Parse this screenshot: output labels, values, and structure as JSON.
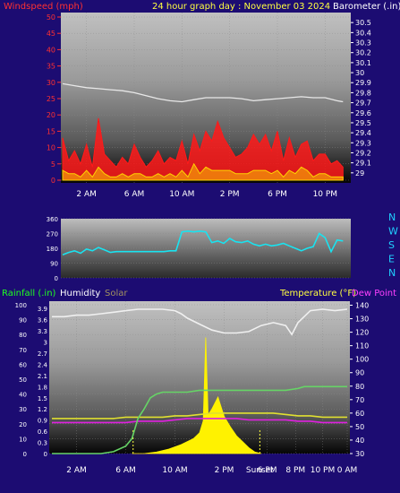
{
  "colors": {
    "background": "#1c0c72",
    "wind_gust": "#ff1a1a",
    "wind_avg": "#ffd400",
    "barometer": "#e8e8e8",
    "direction": "#19e3f0",
    "humidity": "#f0f0f0",
    "temperature": "#e0e030",
    "dew_point": "#e020e0",
    "rainfall": "#66d466",
    "solar": "#fff200",
    "label_red": "#ff3030",
    "label_white": "#ffffff",
    "label_yellow": "#ffff40",
    "label_cyan": "#20d0ff",
    "label_tan": "#a09060",
    "label_magenta": "#ff40ff",
    "label_green": "#20ff20"
  },
  "labels": {
    "top_left": "Windspeed (mph)",
    "top_center": "24 hour graph day : November 03 2024",
    "top_right": "Barometer (.in)",
    "rainfall": "Rainfall (.in)",
    "humidity": "Humidity",
    "solar": "Solar",
    "temperature": "Temperature (°F)",
    "dew_point": "Dew Point ("
  },
  "chart_data": [
    {
      "type": "area",
      "name": "wind",
      "time_ticks": [
        "2 AM",
        "6 AM",
        "10 AM",
        "2 PM",
        "6 PM",
        "10 PM"
      ],
      "time_tick_hours": [
        2,
        6,
        10,
        14,
        18,
        22
      ],
      "left_axis": {
        "ticks": [
          0,
          5,
          10,
          15,
          20,
          25,
          30,
          35,
          40,
          45,
          50
        ],
        "ylim": [
          0,
          50
        ]
      },
      "right_axis": {
        "ticks": [
          "29",
          "29.1",
          "29.2",
          "29.3",
          "29.4",
          "29.5",
          "29.6",
          "29.7",
          "29.8",
          "29.9",
          "30",
          "30.1",
          "30.2",
          "30.3",
          "30.4",
          "30.5"
        ],
        "ylim": [
          28.9,
          30.6
        ]
      },
      "series": [
        {
          "key": "gust",
          "color_key": "wind_gust",
          "x": [
            0,
            0.5,
            1,
            1.5,
            2,
            2.5,
            3,
            3.5,
            4,
            4.5,
            5,
            5.5,
            6,
            6.5,
            7,
            7.5,
            8,
            8.5,
            9,
            9.5,
            10,
            10.5,
            11,
            11.5,
            12,
            12.5,
            13,
            13.5,
            14,
            14.5,
            15,
            15.5,
            16,
            16.5,
            17,
            17.5,
            18,
            18.5,
            19,
            19.5,
            20,
            20.5,
            21,
            21.5,
            22,
            22.5,
            23,
            23.5
          ],
          "values": [
            13,
            6,
            9,
            5,
            11,
            4,
            19,
            8,
            6,
            4,
            7,
            5,
            11,
            7,
            4,
            6,
            9,
            5,
            7,
            6,
            12,
            5,
            14,
            9,
            15,
            12,
            18,
            13,
            10,
            7,
            8,
            10,
            14,
            11,
            14,
            9,
            15,
            6,
            13,
            7,
            11,
            12,
            6,
            8,
            8,
            5,
            6,
            4
          ]
        },
        {
          "key": "avg",
          "color_key": "wind_avg",
          "x": [
            0,
            0.5,
            1,
            1.5,
            2,
            2.5,
            3,
            3.5,
            4,
            4.5,
            5,
            5.5,
            6,
            6.5,
            7,
            7.5,
            8,
            8.5,
            9,
            9.5,
            10,
            10.5,
            11,
            11.5,
            12,
            12.5,
            13,
            13.5,
            14,
            14.5,
            15,
            15.5,
            16,
            16.5,
            17,
            17.5,
            18,
            18.5,
            19,
            19.5,
            20,
            20.5,
            21,
            21.5,
            22,
            22.5,
            23,
            23.5
          ],
          "values": [
            3,
            2,
            2,
            1,
            3,
            1,
            4,
            2,
            1,
            1,
            2,
            1,
            2,
            2,
            1,
            1,
            2,
            1,
            2,
            1,
            3,
            1,
            5,
            2,
            4,
            3,
            3,
            3,
            3,
            2,
            2,
            2,
            3,
            3,
            3,
            2,
            3,
            1,
            3,
            2,
            4,
            3,
            1,
            2,
            2,
            1,
            1,
            1
          ]
        },
        {
          "key": "barometer",
          "color_key": "barometer",
          "axis": "right",
          "x": [
            0,
            1,
            2,
            3,
            4,
            5,
            6,
            7,
            8,
            9,
            10,
            11,
            12,
            13,
            14,
            15,
            16,
            17,
            18,
            19,
            20,
            21,
            22,
            23,
            23.5
          ],
          "values": [
            29.89,
            29.87,
            29.85,
            29.84,
            29.83,
            29.82,
            29.8,
            29.77,
            29.74,
            29.72,
            29.71,
            29.73,
            29.75,
            29.75,
            29.75,
            29.74,
            29.72,
            29.73,
            29.74,
            29.75,
            29.76,
            29.75,
            29.75,
            29.72,
            29.71
          ]
        }
      ]
    },
    {
      "type": "line",
      "name": "wind_direction",
      "left_axis": {
        "ticks": [
          0,
          90,
          180,
          270,
          360
        ],
        "ylim": [
          0,
          360
        ]
      },
      "right_labels": [
        "N",
        "W",
        "S",
        "E",
        "N"
      ],
      "series": [
        {
          "key": "direction",
          "color_key": "direction",
          "x": [
            0,
            0.5,
            1,
            1.5,
            2,
            2.5,
            3,
            3.5,
            4,
            4.5,
            5,
            5.5,
            6,
            6.5,
            7,
            7.5,
            8,
            8.5,
            9,
            9.5,
            10,
            10.5,
            11,
            11.5,
            12,
            12.5,
            13,
            13.5,
            14,
            14.5,
            15,
            15.5,
            16,
            16.5,
            17,
            17.5,
            18,
            18.5,
            19,
            19.5,
            20,
            20.5,
            21,
            21.5,
            22,
            22.5,
            23,
            23.5
          ],
          "values": [
            140,
            155,
            165,
            150,
            175,
            165,
            185,
            170,
            155,
            160,
            160,
            160,
            160,
            160,
            160,
            160,
            160,
            160,
            165,
            165,
            280,
            285,
            280,
            285,
            280,
            215,
            225,
            210,
            240,
            220,
            215,
            225,
            205,
            195,
            205,
            195,
            200,
            210,
            195,
            180,
            165,
            180,
            190,
            270,
            245,
            160,
            230,
            225
          ]
        }
      ]
    },
    {
      "type": "line",
      "name": "humidity_temperature_rain_solar",
      "time_ticks": [
        "2 AM",
        "6 AM",
        "10 AM",
        "2 PM",
        "Sunset",
        "6 PM",
        "8 PM",
        "10 PM",
        "0 AM"
      ],
      "time_tick_hours": [
        2,
        6,
        10,
        14,
        16.9,
        17.5,
        19.8,
        22,
        24
      ],
      "sunrise_hour": 6.6,
      "sunset_hour": 16.9,
      "humidity_axis": {
        "ticks": [
          0,
          10,
          20,
          30,
          40,
          50,
          60,
          70,
          80,
          90,
          100
        ],
        "ylim": [
          0,
          100
        ]
      },
      "rain_axis": {
        "ticks": [
          "0",
          "0.3",
          "0.6",
          "0.9",
          "1.2",
          "1.5",
          "1.8",
          "2.1",
          "2.4",
          "2.7",
          "3",
          "3.3",
          "3.6",
          "3.9"
        ],
        "ylim": [
          0,
          4
        ]
      },
      "temperature_axis": {
        "ticks": [
          30,
          40,
          50,
          60,
          70,
          80,
          90,
          100,
          110,
          120,
          130,
          140
        ],
        "ylim": [
          30,
          143
        ]
      },
      "series": [
        {
          "key": "humidity",
          "color_key": "humidity",
          "axis": "humidity",
          "x": [
            0,
            1,
            2,
            3,
            4,
            5,
            6,
            7,
            8,
            9,
            10,
            10.5,
            11,
            12,
            13,
            14,
            15,
            16,
            17,
            18,
            19,
            19.5,
            20,
            21,
            22,
            23,
            24
          ],
          "values": [
            92,
            92,
            93,
            93,
            94,
            95,
            96,
            97,
            97,
            97,
            96,
            94,
            91,
            87,
            83,
            81,
            81,
            82,
            86,
            88,
            86,
            80,
            88,
            96,
            97,
            96,
            97
          ]
        },
        {
          "key": "temperature",
          "color_key": "temperature",
          "axis": "temperature",
          "x": [
            0,
            1,
            2,
            3,
            4,
            5,
            6,
            7,
            8,
            9,
            10,
            11,
            12,
            13,
            14,
            15,
            16,
            17,
            18,
            19,
            20,
            21,
            22,
            23,
            24
          ],
          "values": [
            56,
            56,
            56,
            56,
            56,
            56,
            57,
            57,
            57,
            57,
            58,
            58,
            59,
            60,
            60,
            60,
            60,
            60,
            60,
            59,
            58,
            58,
            57,
            57,
            57
          ]
        },
        {
          "key": "dew_point",
          "color_key": "dew_point",
          "axis": "temperature",
          "x": [
            0,
            1,
            2,
            3,
            4,
            5,
            6,
            7,
            8,
            9,
            10,
            11,
            12,
            13,
            14,
            15,
            16,
            17,
            18,
            19,
            20,
            21,
            22,
            23,
            24
          ],
          "values": [
            53,
            53,
            53,
            53,
            53,
            53,
            53,
            54,
            54,
            54,
            55,
            56,
            56,
            56,
            56,
            56,
            55,
            55,
            55,
            55,
            54,
            54,
            53,
            53,
            53
          ]
        },
        {
          "key": "rainfall",
          "color_key": "rainfall",
          "axis": "rain",
          "x": [
            0,
            4,
            5,
            6,
            6.5,
            7,
            7.5,
            8,
            8.5,
            9,
            10,
            11,
            12,
            13,
            14,
            15,
            16,
            17,
            18,
            19,
            20,
            20.5,
            21,
            22,
            23,
            23.5,
            24
          ],
          "values": [
            0,
            0,
            0.05,
            0.2,
            0.4,
            0.95,
            1.2,
            1.5,
            1.6,
            1.65,
            1.65,
            1.65,
            1.7,
            1.7,
            1.7,
            1.7,
            1.7,
            1.7,
            1.7,
            1.7,
            1.75,
            1.8,
            1.8,
            1.8,
            1.8,
            1.8,
            1.8
          ]
        },
        {
          "key": "solar",
          "color_key": "solar",
          "axis": "humidity",
          "x": [
            6.5,
            7.5,
            8.5,
            9.5,
            10.5,
            11.5,
            12,
            12.3,
            12.5,
            12.7,
            13,
            13.5,
            14,
            14.5,
            15,
            15.5,
            16,
            16.5,
            17
          ],
          "values": [
            0,
            0,
            1,
            3,
            6,
            10,
            14,
            22,
            78,
            26,
            30,
            38,
            25,
            18,
            12,
            8,
            4,
            1,
            0
          ]
        }
      ]
    }
  ]
}
